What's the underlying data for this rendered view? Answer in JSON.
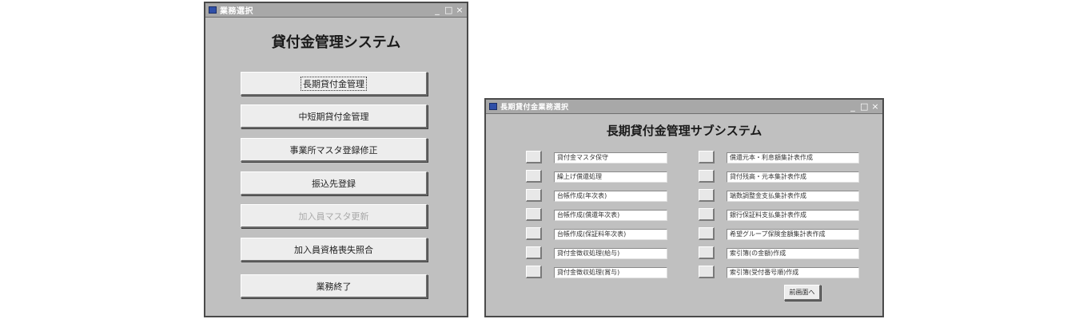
{
  "window1": {
    "title": "業務選択",
    "heading": "貸付金管理システム",
    "buttons": [
      {
        "label": "長期貸付金管理",
        "state": "focused"
      },
      {
        "label": "中短期貸付金管理",
        "state": "normal"
      },
      {
        "label": "事業所マスタ登録修正",
        "state": "normal"
      },
      {
        "label": "振込先登録",
        "state": "normal"
      },
      {
        "label": "加入員マスタ更新",
        "state": "disabled"
      },
      {
        "label": "加入員資格喪失照合",
        "state": "normal"
      },
      {
        "label": "業務終了",
        "state": "normal"
      }
    ]
  },
  "window2": {
    "title": "長期貸付金業務選択",
    "heading": "長期貸付金管理サブシステム",
    "left_items": [
      "貸付金マスタ保守",
      "繰上げ償還処理",
      "台帳作成(年次表)",
      "台帳作成(償還年次表)",
      "台帳作成(保証料年次表)",
      "貸付金徴収処理(給与)",
      "貸付金徴収処理(賞与)"
    ],
    "right_items": [
      "償還元本・利息額集計表作成",
      "貸付残高・元本集計表作成",
      "端数調整金支払集計表作成",
      "銀行保証料支払集計表作成",
      "希望グループ保険金額集計表作成",
      "索引簿(の金額)作成",
      "索引簿(受付番号順)作成"
    ],
    "back_button": "前画面へ"
  },
  "controls": {
    "minimize": "_",
    "maximize": "□",
    "close": "×"
  },
  "colors": {
    "window_bg": "#c0c0c0",
    "titlebar": "#a8a8a8",
    "button_face": "#ededed"
  }
}
